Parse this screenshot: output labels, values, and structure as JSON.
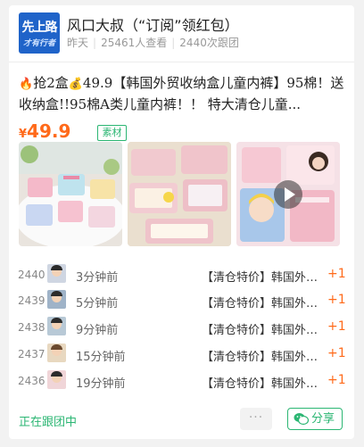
{
  "post": {
    "avatar_line1": "先上路",
    "avatar_line2": "才有行者",
    "shop_name": "风口大叔（“订阅”领红包）",
    "time": "昨天",
    "views": "25461人查看",
    "joins": "2440次跟团",
    "desc_part1": "抢2盒",
    "desc_part2": "49.9【韩国外贸收纳盒儿童内裤】95棉！送收纳盒!!95棉A类儿童内裤！！ 特大清仓儿童...",
    "price_symbol": "¥",
    "price": "49.9",
    "tag": "素材",
    "icons": [
      "fire-icon",
      "money-bag-icon",
      "play-icon",
      "wechat-icon"
    ],
    "accent_color": "#2bb673",
    "price_color": "#ff6a1a"
  },
  "orders": [
    {
      "seq": "2440",
      "time": "3分钟前",
      "item": "【清仓特价】韩国外贸收纳盒儿童内裤",
      "plus": "+1"
    },
    {
      "seq": "2439",
      "time": "5分钟前",
      "item": "【清仓特价】韩国外贸收纳盒儿童内裤",
      "plus": "+1"
    },
    {
      "seq": "2438",
      "time": "9分钟前",
      "item": "【清仓特价】韩国外贸收纳盒儿童内裤",
      "plus": "+1"
    },
    {
      "seq": "2437",
      "time": "15分钟前",
      "item": "【清仓特价】韩国外贸收纳盒儿童内裤",
      "plus": "+1"
    },
    {
      "seq": "2436",
      "time": "19分钟前",
      "item": "【清仓特价】韩国外贸收纳盒儿童内裤",
      "plus": "+1"
    }
  ],
  "footer": {
    "status": "正在跟团中",
    "more": "···",
    "share": "分享"
  }
}
